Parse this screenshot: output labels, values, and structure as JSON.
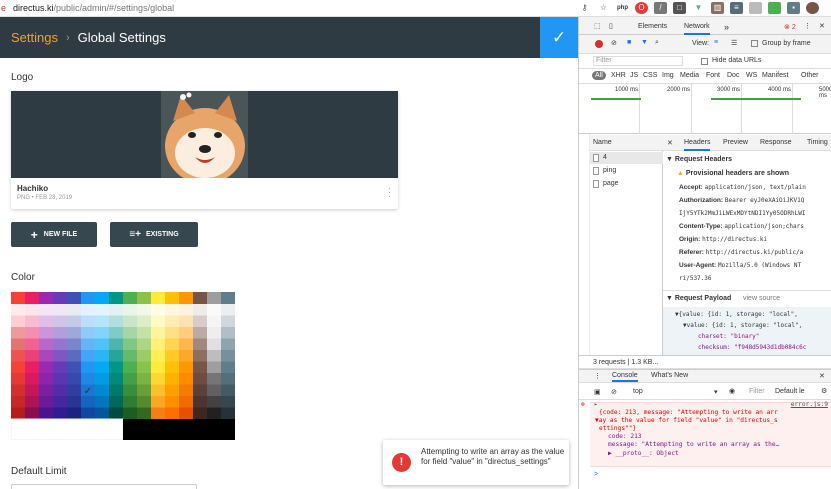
{
  "browser": {
    "error_icon": "error-icon",
    "url_host": "directus.ki",
    "url_path": "/public/admin/#/settings/global",
    "ext_icons": [
      "key-icon",
      "star-icon",
      "php-icon",
      "opera-icon",
      "eyedropper-icon",
      "document-icon",
      "vue-icon",
      "chart-icon",
      "list-icon",
      "square-icon",
      "square-icon",
      "lock-icon",
      "avatar-icon",
      "menu-icon"
    ],
    "php_label": "php"
  },
  "header": {
    "breadcrumb": "Settings",
    "separator": "›",
    "title": "Global Settings",
    "save_icon": "check-icon",
    "colors": {
      "bg": "#2f3b43",
      "accent": "#f6a023",
      "save": "#2196f3"
    }
  },
  "logo": {
    "label": "Logo",
    "file_name": "Hachiko",
    "file_meta": "PNG • FEB 28, 2019",
    "more_icon": "more-vert-icon"
  },
  "buttons": {
    "new_file": "NEW FILE",
    "existing": "EXISTING"
  },
  "color": {
    "label": "Color",
    "selected_icon": "check-icon"
  },
  "default_limit": {
    "label": "Default Limit"
  },
  "toast": {
    "icon": "error-icon",
    "message": "Attempting to write an array as the value for field \"value\" in \"directus_settings\""
  },
  "devtools": {
    "tabs": [
      "Elements",
      "Network"
    ],
    "more_tabs": "»",
    "error_count": "2",
    "toolbar": {
      "view_label": "View:",
      "group_by_frame": "Group by frame"
    },
    "filter": {
      "placeholder": "Filter",
      "hide_data_urls": "Hide data URLs"
    },
    "type_filters": [
      "All",
      "XHR",
      "JS",
      "CSS",
      "Img",
      "Media",
      "Font",
      "Doc",
      "WS",
      "Manifest",
      "Other"
    ],
    "timeline_ticks": [
      "1000 ms",
      "2000 ms",
      "3000 ms",
      "4000 ms",
      "5000 ms"
    ],
    "list_header": "Name",
    "requests": [
      "4",
      "ping",
      "page"
    ],
    "detail_tabs": [
      "Headers",
      "Preview",
      "Response",
      "Timing"
    ],
    "request_headers_title": "Request Headers",
    "provisional": "Provisional headers are shown",
    "headers": [
      {
        "k": "Accept:",
        "v": "application/json, text/plain"
      },
      {
        "k": "Authorization:",
        "v": "Bearer eyJ0eXAiOiJKV1Q"
      },
      {
        "k": "",
        "v": "IjY5YTk2MmJiLWExMDYtNDI1Yy05ODRhLWI"
      },
      {
        "k": "Content-Type:",
        "v": "application/json;chars"
      },
      {
        "k": "Origin:",
        "v": "http://directus.ki"
      },
      {
        "k": "Referer:",
        "v": "http://directus.ki/public/a"
      },
      {
        "k": "User-Agent:",
        "v": "Mozilla/5.0 (Windows NT"
      },
      {
        "k": "",
        "v": "ri/537.36"
      }
    ],
    "payload_title": "Request Payload",
    "view_source": "view source",
    "payload_lines": [
      "▼{value: {id: 1, storage: \"local\",",
      "▼value: {id: 1, storage: \"local\",",
      "charset: \"binary\"",
      "checksum: \"f948d5943d1db084c6c"
    ],
    "summary": "3 requests | 1.3 KB...",
    "console_tabs": [
      "Console",
      "What's New"
    ],
    "context": "top",
    "console_filter": "Filter",
    "levels": "Default le",
    "error_link": "error.js:9",
    "error_lines": [
      "{code: 213, message: \"Attempting to write an arr",
      "ay as the value for field \"value\" in \"directus_s",
      "ettings\"\"}",
      "code: 213",
      "message: \"Attempting to write an array as the…",
      "▶ __proto__: Object"
    ],
    "prompt": ">"
  }
}
